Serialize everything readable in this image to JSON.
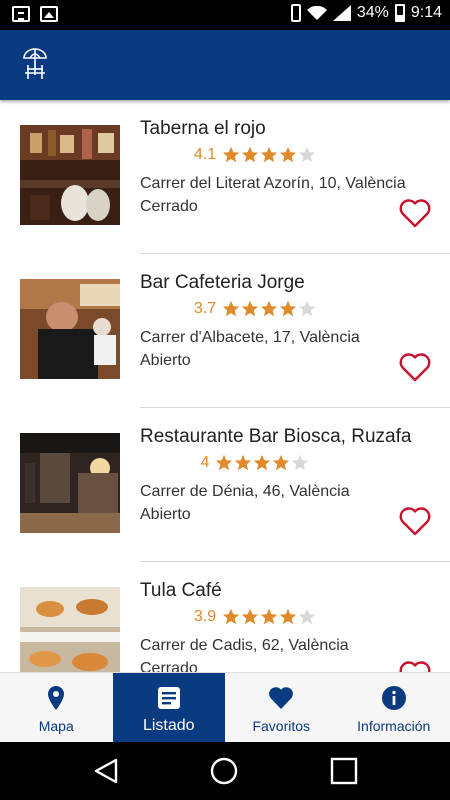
{
  "status_bar": {
    "battery": "34%",
    "time": "9:14"
  },
  "colors": {
    "primary": "#0a3a80",
    "rating": "#e08a2c",
    "star_filled": "#e08a2c",
    "star_empty": "#d8d8d8",
    "heart": "#c8102e"
  },
  "app_bar": {
    "logo_icon": "beach-umbrella-table-icon"
  },
  "restaurants": [
    {
      "name": "Taberna el rojo",
      "rating": "4.1",
      "stars": 4,
      "address": "Carrer del Literat Azorín, 10, València",
      "status": "Cerrado"
    },
    {
      "name": "Bar Cafeteria Jorge",
      "rating": "3.7",
      "stars": 4,
      "address": "Carrer d'Albacete, 17, València",
      "status": "Abierto"
    },
    {
      "name": "Restaurante Bar Biosca, Ruzafa",
      "rating": "4",
      "stars": 4,
      "address": "Carrer de Dénia, 46, València",
      "status": "Abierto"
    },
    {
      "name": "Tula Café",
      "rating": "3.9",
      "stars": 4,
      "address": "Carrer de Cadis, 62, València",
      "status": "Cerrado"
    }
  ],
  "bottom_nav": [
    {
      "label": "Mapa",
      "icon": "map-pin-icon",
      "active": false
    },
    {
      "label": "Listado",
      "icon": "list-icon",
      "active": true
    },
    {
      "label": "Favoritos",
      "icon": "heart-icon",
      "active": false
    },
    {
      "label": "Información",
      "icon": "info-icon",
      "active": false
    }
  ]
}
